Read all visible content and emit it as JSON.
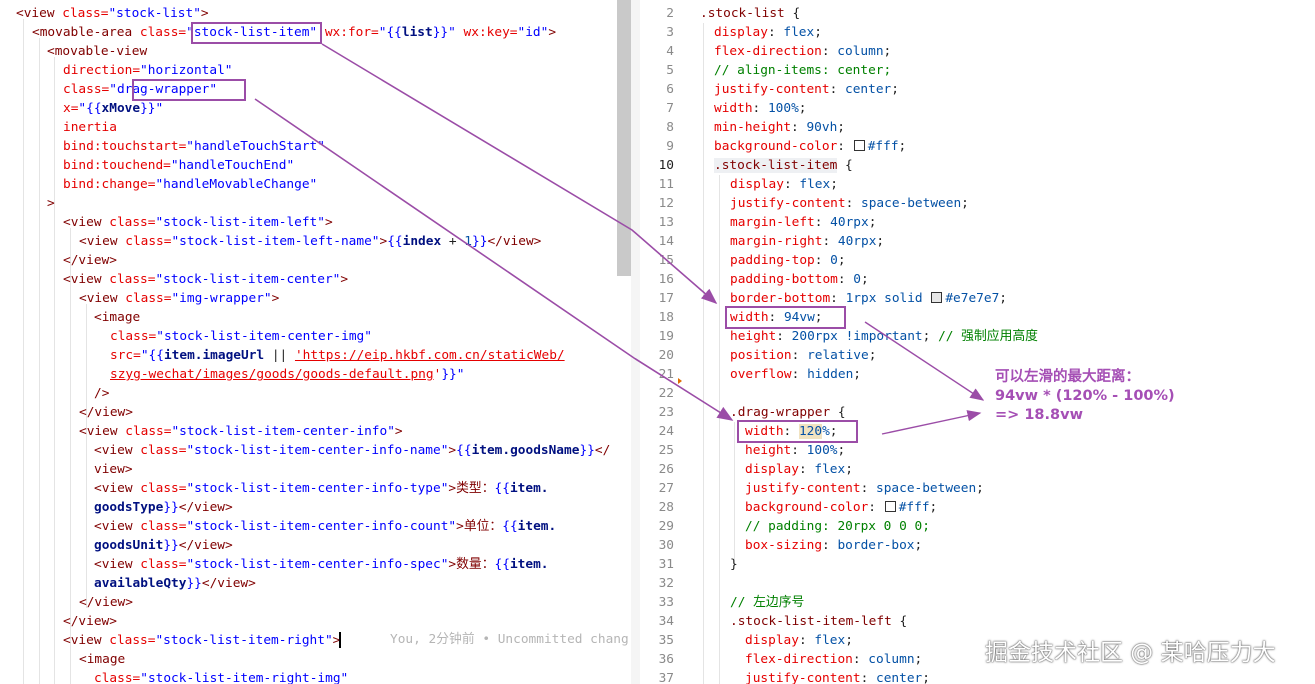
{
  "left": {
    "l1_tag": "<view",
    "l1_attr": " class=",
    "l1_val": "\"stock-list\"",
    "l1_end": ">",
    "l2_tag": "<movable-area",
    "l2_attr": " class=",
    "l2_q": "\"",
    "l2_val": "stock-list-item",
    "l2_q2": "\"",
    "l2_for": " wx:for=",
    "l2_forv1": "\"{{",
    "l2_forv2": "list",
    "l2_forv3": "}}\"",
    "l2_key": " wx:key=",
    "l2_keyv": "\"id\"",
    "l2_end": ">",
    "l3": "<movable-view",
    "l4a": "direction=",
    "l4b": "\"horizontal\"",
    "l5a": "class=",
    "l5b": "\"drag-wrapper\"",
    "l6a": "x=",
    "l6b": "\"{{",
    "l6c": "xMove",
    "l6d": "}}\"",
    "l7": "inertia",
    "l8a": "bind:touchstart=",
    "l8b": "\"handleTouchStart\"",
    "l9a": "bind:touchend=",
    "l9b": "\"handleTouchEnd\"",
    "l10a": "bind:change=",
    "l10b": "\"handleMovableChange\"",
    "l11": ">",
    "l12a": "<view",
    "l12b": " class=",
    "l12c": "\"stock-list-item-left\"",
    "l12d": ">",
    "l13a": "<view",
    "l13b": " class=",
    "l13c": "\"stock-list-item-left-name\"",
    "l13d": ">",
    "l13e": "{{",
    "l13f": "index",
    "l13g": " + ",
    "l13h": "1",
    "l13i": "}}",
    "l13j": "</view>",
    "l14": "</view>",
    "l15a": "<view",
    "l15b": " class=",
    "l15c": "\"stock-list-item-center\"",
    "l15d": ">",
    "l16a": "<view",
    "l16b": " class=",
    "l16c": "\"img-wrapper\"",
    "l16d": ">",
    "l17": "<image",
    "l18a": "class=",
    "l18b": "\"stock-list-item-center-img\"",
    "l19a": "src=",
    "l19b": "\"{{",
    "l19c": "item.imageUrl",
    "l19d": " || ",
    "l19e": "'https://eip.hkbf.com.cn/staticWeb/",
    "l20a": "szyg-wechat/images/goods/goods-default.png",
    "l20b": "'",
    "l20c": "}}\"",
    "l21": "/>",
    "l22": "</view>",
    "l23a": "<view",
    "l23b": " class=",
    "l23c": "\"stock-list-item-center-info\"",
    "l23d": ">",
    "l24a": "<view",
    "l24b": " class=",
    "l24c": "\"stock-list-item-center-info-name\"",
    "l24d": ">",
    "l24e": "{{",
    "l24f": "item.goodsName",
    "l24g": "}}",
    "l24h": "</",
    "l25": "view>",
    "l26a": "<view",
    "l26b": " class=",
    "l26c": "\"stock-list-item-center-info-type\"",
    "l26d": ">类型：",
    "l26e": "{{",
    "l26f": "item.",
    "l27a": "goodsType",
    "l27b": "}}",
    "l27c": "</view>",
    "l28a": "<view",
    "l28b": " class=",
    "l28c": "\"stock-list-item-center-info-count\"",
    "l28d": ">单位：",
    "l28e": "{{",
    "l28f": "item.",
    "l29a": "goodsUnit",
    "l29b": "}}",
    "l29c": "</view>",
    "l30a": "<view",
    "l30b": " class=",
    "l30c": "\"stock-list-item-center-info-spec\"",
    "l30d": ">数量：",
    "l30e": "{{",
    "l30f": "item.",
    "l31a": "availableQty",
    "l31b": "}}",
    "l31c": "</view>",
    "l32": "</view>",
    "l33": "</view>",
    "l34a": "<view",
    "l34b": " class=",
    "l34c": "\"stock-list-item-right\"",
    "l34d": ">",
    "l35": "<image",
    "l36a": "class=",
    "l36b": "\"stock-list-item-right-img\"",
    "blame": "You, 2分钟前 • Uncommitted chang"
  },
  "right": {
    "lines": [
      "2",
      "3",
      "4",
      "5",
      "6",
      "7",
      "8",
      "9",
      "10",
      "11",
      "12",
      "13",
      "14",
      "15",
      "16",
      "17",
      "18",
      "19",
      "20",
      "21",
      "22",
      "23",
      "24",
      "25",
      "26",
      "27",
      "28",
      "29",
      "30",
      "31",
      "32",
      "33",
      "34",
      "35",
      "36",
      "37"
    ],
    "r2": ".stock-list",
    "r2b": " {",
    "r3p": "display",
    "r3v": "flex",
    "r4p": "flex-direction",
    "r4v": "column",
    "r5": "// align-items: center;",
    "r6p": "justify-content",
    "r6v": "center",
    "r7p": "width",
    "r7v": "100%",
    "r8p": "min-height",
    "r8v": "90vh",
    "r9p": "background-color",
    "r9v": "#fff",
    "r10": ".stock-list-item",
    "r10b": " {",
    "r11p": "display",
    "r11v": "flex",
    "r12p": "justify-content",
    "r12v": "space-between",
    "r13p": "margin-left",
    "r13v": "40rpx",
    "r14p": "margin-right",
    "r14v": "40rpx",
    "r15p": "padding-top",
    "r15v": "0",
    "r16p": "padding-bottom",
    "r16v": "0",
    "r17p": "border-bottom",
    "r17v1": "1rpx solid ",
    "r17v2": "#e7e7e7",
    "r18p": "width",
    "r18v": "94vw",
    "r19p": "height",
    "r19v": "200rpx !important",
    "r19c": "// 强制应用高度",
    "r20p": "position",
    "r20v": "relative",
    "r21p": "overflow",
    "r21v": "hidden",
    "r23": ".drag-wrapper",
    "r23b": " {",
    "r24p": "width",
    "r24v1": "120",
    "r24v2": "%",
    "r25p": "height",
    "r25v": "100%",
    "r26p": "display",
    "r26v": "flex",
    "r27p": "justify-content",
    "r27v": "space-between",
    "r28p": "background-color",
    "r28v": "#fff",
    "r29": "// padding: 20rpx 0 0 0;",
    "r30p": "box-sizing",
    "r30v": "border-box",
    "r31": "}",
    "r33": "// 左边序号",
    "r34": ".stock-list-item-left",
    "r34b": " {",
    "r35p": "display",
    "r35v": "flex",
    "r36p": "flex-direction",
    "r36v": "column",
    "r37p": "justify-content",
    "r37v": "center"
  },
  "annotation": {
    "line1": "可以左滑的最大距离：",
    "line2": "94vw * (120% - 100%)",
    "line3": "=> 18.8vw"
  },
  "watermark": "掘金技术社区 @ 某哈压力大",
  "accent_color": "#9b4da7"
}
